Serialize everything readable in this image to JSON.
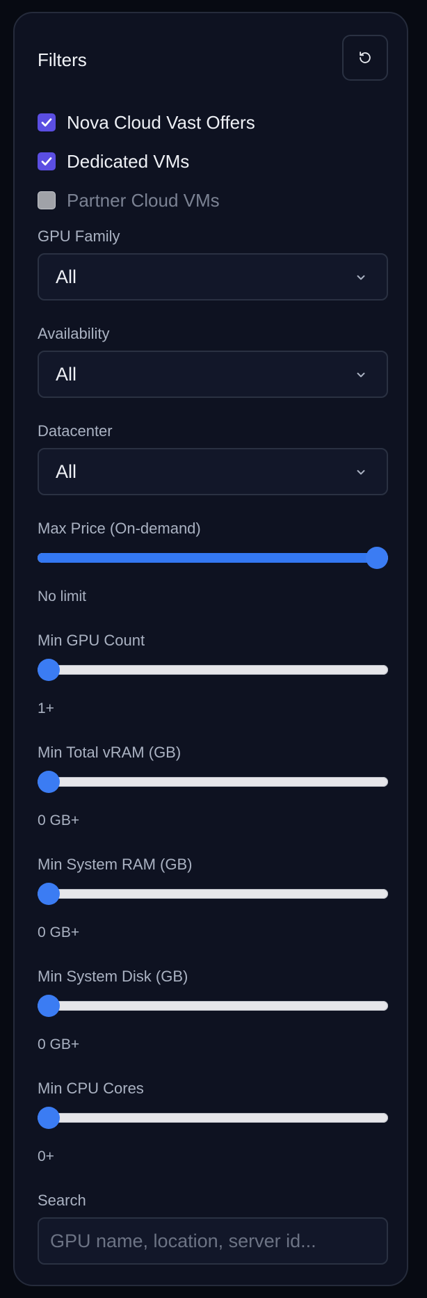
{
  "panel": {
    "title": "Filters",
    "reset_icon": "reset-icon"
  },
  "sources": [
    {
      "label": "Nova Cloud Vast Offers",
      "checked": true
    },
    {
      "label": "Dedicated VMs",
      "checked": true
    },
    {
      "label": "Partner Cloud VMs",
      "checked": false
    }
  ],
  "selects": {
    "gpu_family": {
      "label": "GPU Family",
      "value": "All"
    },
    "availability": {
      "label": "Availability",
      "value": "All"
    },
    "datacenter": {
      "label": "Datacenter",
      "value": "All"
    }
  },
  "sliders": {
    "max_price": {
      "label": "Max Price (On-demand)",
      "value_text": "No limit",
      "level": 1.0
    },
    "min_gpu_count": {
      "label": "Min GPU Count",
      "value_text": "1+",
      "level": 0.0
    },
    "min_total_vram": {
      "label": "Min Total vRAM (GB)",
      "value_text": "0 GB+",
      "level": 0.0
    },
    "min_system_ram": {
      "label": "Min System RAM (GB)",
      "value_text": "0 GB+",
      "level": 0.0
    },
    "min_system_disk": {
      "label": "Min System Disk (GB)",
      "value_text": "0 GB+",
      "level": 0.0
    },
    "min_cpu_cores": {
      "label": "Min CPU Cores",
      "value_text": "0+",
      "level": 0.0
    }
  },
  "search": {
    "label": "Search",
    "placeholder": "GPU name, location, server id...",
    "value": ""
  },
  "colors": {
    "accent": "#3478f2",
    "checkbox_checked": "#5b4ee2",
    "panel_bg": "#0e1221"
  }
}
